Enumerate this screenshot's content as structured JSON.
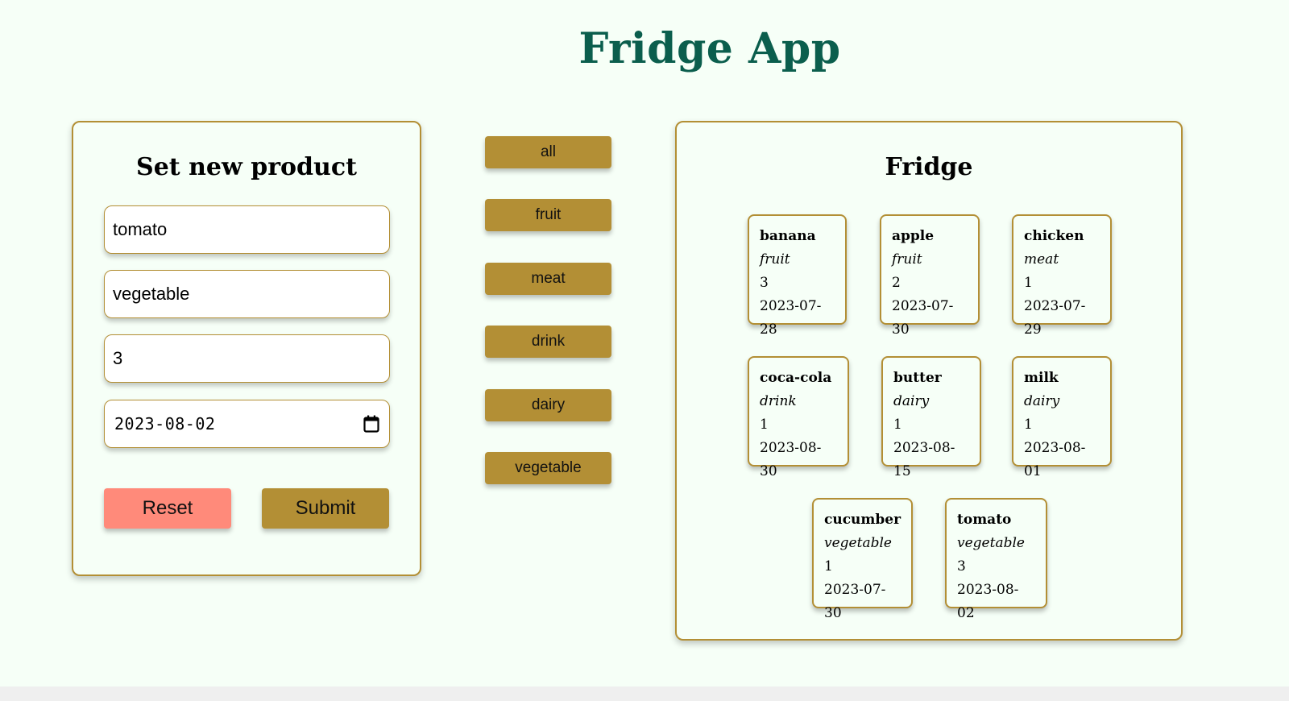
{
  "app": {
    "title": "Fridge App"
  },
  "colors": {
    "background": "#f6fff7",
    "accent_gold": "#b38f35",
    "reset_salmon": "#ff8a7a",
    "title_green": "#0b5e4d"
  },
  "form": {
    "title": "Set new product",
    "fields": {
      "name": "tomato",
      "category": "vegetable",
      "quantity": "3",
      "date": "2023-08-02"
    },
    "date_icon": "calendar-icon",
    "reset_label": "Reset",
    "submit_label": "Submit"
  },
  "filters": [
    {
      "label": "all"
    },
    {
      "label": "fruit"
    },
    {
      "label": "meat"
    },
    {
      "label": "drink"
    },
    {
      "label": "dairy"
    },
    {
      "label": "vegetable"
    }
  ],
  "fridge": {
    "title": "Fridge",
    "items": [
      {
        "name": "banana",
        "category": "fruit",
        "quantity": "3",
        "date": "2023-07-28"
      },
      {
        "name": "apple",
        "category": "fruit",
        "quantity": "2",
        "date": "2023-07-30"
      },
      {
        "name": "chicken",
        "category": "meat",
        "quantity": "1",
        "date": "2023-07-29"
      },
      {
        "name": "coca-cola",
        "category": "drink",
        "quantity": "1",
        "date": "2023-08-30"
      },
      {
        "name": "butter",
        "category": "dairy",
        "quantity": "1",
        "date": "2023-08-15"
      },
      {
        "name": "milk",
        "category": "dairy",
        "quantity": "1",
        "date": "2023-08-01"
      },
      {
        "name": "cucumber",
        "category": "vegetable",
        "quantity": "1",
        "date": "2023-07-30"
      },
      {
        "name": "tomato",
        "category": "vegetable",
        "quantity": "3",
        "date": "2023-08-02"
      }
    ]
  }
}
